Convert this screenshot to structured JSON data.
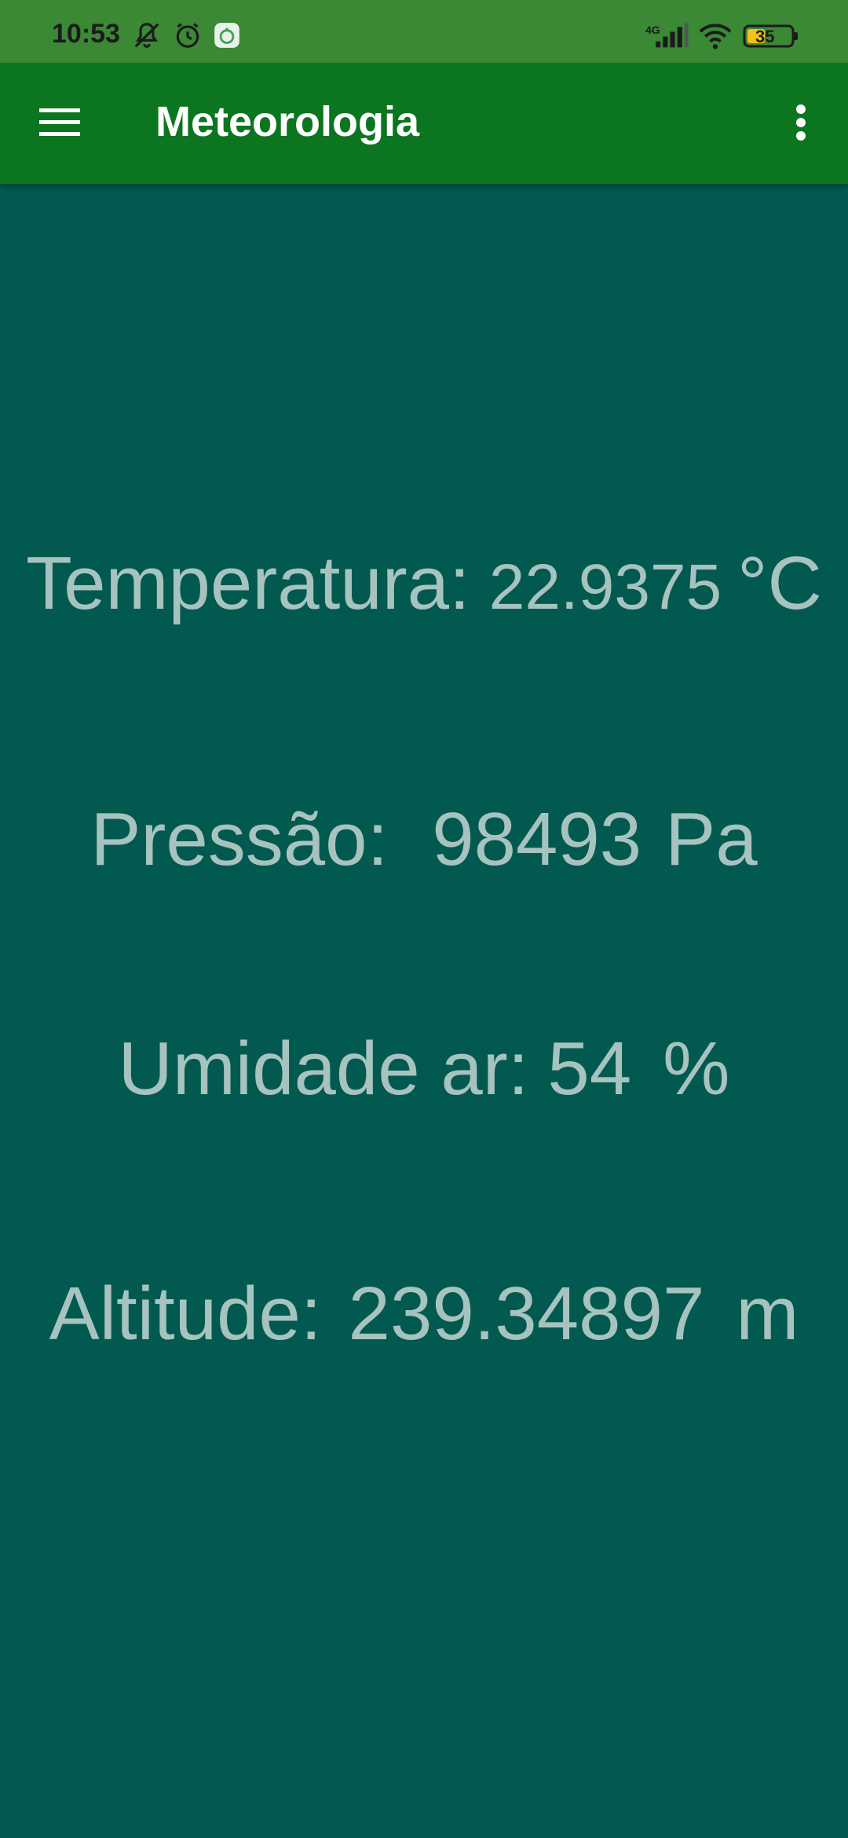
{
  "status_bar": {
    "time": "10:53",
    "network": "4G",
    "battery": "35",
    "icons": [
      "mute-icon",
      "alarm-icon",
      "app-notification-icon",
      "signal-icon",
      "wifi-icon",
      "battery-icon"
    ]
  },
  "app_bar": {
    "title": "Meteorologia",
    "menu_icon": "hamburger-menu-icon",
    "overflow_icon": "more-vert-icon"
  },
  "readings": {
    "temperature": {
      "label": "Temperatura:",
      "value": "22.9375",
      "unit": "°C"
    },
    "pressure": {
      "label": "Pressão:",
      "value": "98493",
      "unit": "Pa"
    },
    "humidity": {
      "label": "Umidade ar:",
      "value": "54",
      "unit": "%"
    },
    "altitude": {
      "label": "Altitude:",
      "value": "239.34897",
      "unit": "m"
    }
  },
  "colors": {
    "status_bar": "#3B8835",
    "app_bar": "#0C7520",
    "background": "#01594F",
    "reading_text": "#A7C3BF"
  }
}
